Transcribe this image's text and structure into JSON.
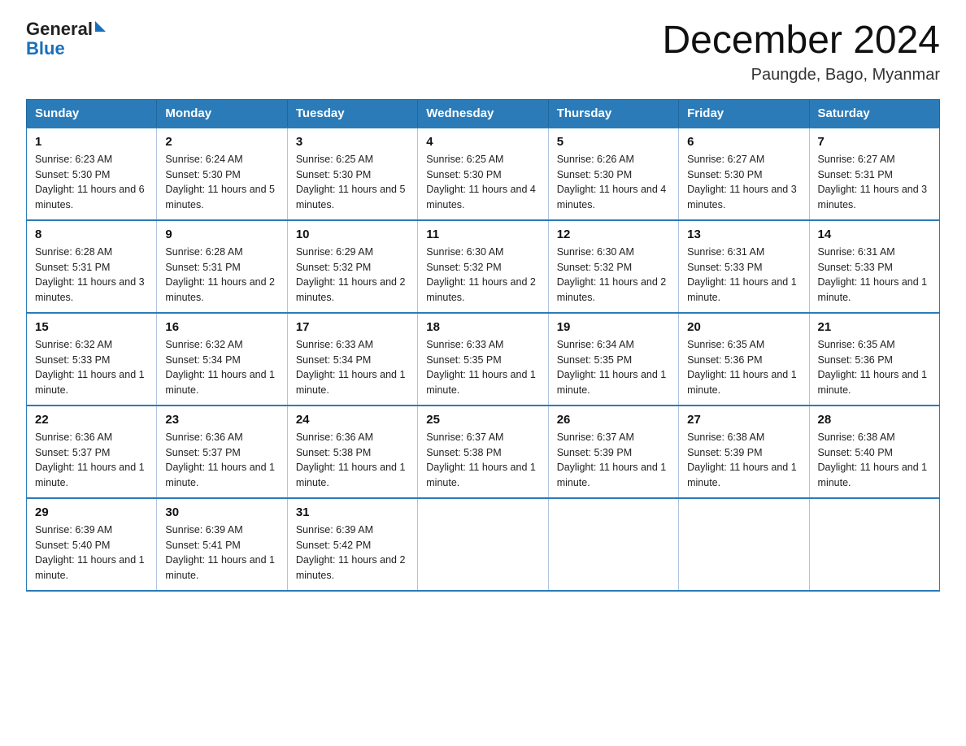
{
  "header": {
    "logo_general": "General",
    "logo_blue": "Blue",
    "month_title": "December 2024",
    "location": "Paungde, Bago, Myanmar"
  },
  "days_of_week": [
    "Sunday",
    "Monday",
    "Tuesday",
    "Wednesday",
    "Thursday",
    "Friday",
    "Saturday"
  ],
  "weeks": [
    [
      {
        "day": "1",
        "sunrise": "6:23 AM",
        "sunset": "5:30 PM",
        "daylight": "11 hours and 6 minutes."
      },
      {
        "day": "2",
        "sunrise": "6:24 AM",
        "sunset": "5:30 PM",
        "daylight": "11 hours and 5 minutes."
      },
      {
        "day": "3",
        "sunrise": "6:25 AM",
        "sunset": "5:30 PM",
        "daylight": "11 hours and 5 minutes."
      },
      {
        "day": "4",
        "sunrise": "6:25 AM",
        "sunset": "5:30 PM",
        "daylight": "11 hours and 4 minutes."
      },
      {
        "day": "5",
        "sunrise": "6:26 AM",
        "sunset": "5:30 PM",
        "daylight": "11 hours and 4 minutes."
      },
      {
        "day": "6",
        "sunrise": "6:27 AM",
        "sunset": "5:30 PM",
        "daylight": "11 hours and 3 minutes."
      },
      {
        "day": "7",
        "sunrise": "6:27 AM",
        "sunset": "5:31 PM",
        "daylight": "11 hours and 3 minutes."
      }
    ],
    [
      {
        "day": "8",
        "sunrise": "6:28 AM",
        "sunset": "5:31 PM",
        "daylight": "11 hours and 3 minutes."
      },
      {
        "day": "9",
        "sunrise": "6:28 AM",
        "sunset": "5:31 PM",
        "daylight": "11 hours and 2 minutes."
      },
      {
        "day": "10",
        "sunrise": "6:29 AM",
        "sunset": "5:32 PM",
        "daylight": "11 hours and 2 minutes."
      },
      {
        "day": "11",
        "sunrise": "6:30 AM",
        "sunset": "5:32 PM",
        "daylight": "11 hours and 2 minutes."
      },
      {
        "day": "12",
        "sunrise": "6:30 AM",
        "sunset": "5:32 PM",
        "daylight": "11 hours and 2 minutes."
      },
      {
        "day": "13",
        "sunrise": "6:31 AM",
        "sunset": "5:33 PM",
        "daylight": "11 hours and 1 minute."
      },
      {
        "day": "14",
        "sunrise": "6:31 AM",
        "sunset": "5:33 PM",
        "daylight": "11 hours and 1 minute."
      }
    ],
    [
      {
        "day": "15",
        "sunrise": "6:32 AM",
        "sunset": "5:33 PM",
        "daylight": "11 hours and 1 minute."
      },
      {
        "day": "16",
        "sunrise": "6:32 AM",
        "sunset": "5:34 PM",
        "daylight": "11 hours and 1 minute."
      },
      {
        "day": "17",
        "sunrise": "6:33 AM",
        "sunset": "5:34 PM",
        "daylight": "11 hours and 1 minute."
      },
      {
        "day": "18",
        "sunrise": "6:33 AM",
        "sunset": "5:35 PM",
        "daylight": "11 hours and 1 minute."
      },
      {
        "day": "19",
        "sunrise": "6:34 AM",
        "sunset": "5:35 PM",
        "daylight": "11 hours and 1 minute."
      },
      {
        "day": "20",
        "sunrise": "6:35 AM",
        "sunset": "5:36 PM",
        "daylight": "11 hours and 1 minute."
      },
      {
        "day": "21",
        "sunrise": "6:35 AM",
        "sunset": "5:36 PM",
        "daylight": "11 hours and 1 minute."
      }
    ],
    [
      {
        "day": "22",
        "sunrise": "6:36 AM",
        "sunset": "5:37 PM",
        "daylight": "11 hours and 1 minute."
      },
      {
        "day": "23",
        "sunrise": "6:36 AM",
        "sunset": "5:37 PM",
        "daylight": "11 hours and 1 minute."
      },
      {
        "day": "24",
        "sunrise": "6:36 AM",
        "sunset": "5:38 PM",
        "daylight": "11 hours and 1 minute."
      },
      {
        "day": "25",
        "sunrise": "6:37 AM",
        "sunset": "5:38 PM",
        "daylight": "11 hours and 1 minute."
      },
      {
        "day": "26",
        "sunrise": "6:37 AM",
        "sunset": "5:39 PM",
        "daylight": "11 hours and 1 minute."
      },
      {
        "day": "27",
        "sunrise": "6:38 AM",
        "sunset": "5:39 PM",
        "daylight": "11 hours and 1 minute."
      },
      {
        "day": "28",
        "sunrise": "6:38 AM",
        "sunset": "5:40 PM",
        "daylight": "11 hours and 1 minute."
      }
    ],
    [
      {
        "day": "29",
        "sunrise": "6:39 AM",
        "sunset": "5:40 PM",
        "daylight": "11 hours and 1 minute."
      },
      {
        "day": "30",
        "sunrise": "6:39 AM",
        "sunset": "5:41 PM",
        "daylight": "11 hours and 1 minute."
      },
      {
        "day": "31",
        "sunrise": "6:39 AM",
        "sunset": "5:42 PM",
        "daylight": "11 hours and 2 minutes."
      },
      null,
      null,
      null,
      null
    ]
  ]
}
